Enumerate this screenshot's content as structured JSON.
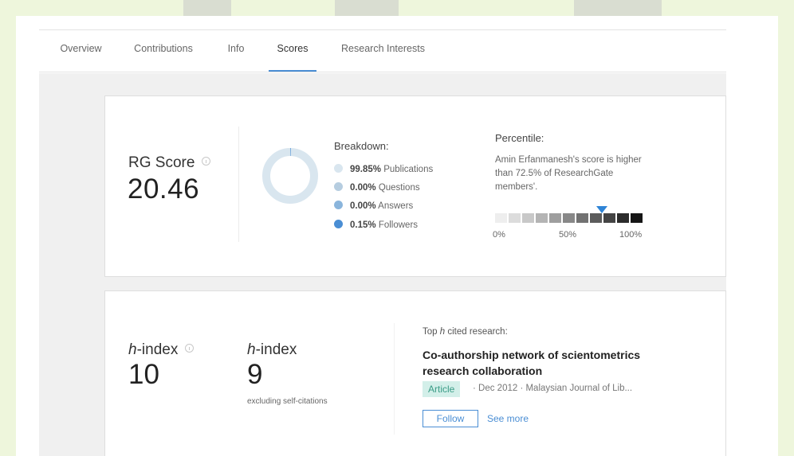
{
  "tabs": [
    {
      "label": "Overview"
    },
    {
      "label": "Contributions"
    },
    {
      "label": "Info"
    },
    {
      "label": "Scores",
      "active": true
    },
    {
      "label": "Research Interests"
    }
  ],
  "rg_score": {
    "label": "RG Score",
    "value": "20.46"
  },
  "breakdown": {
    "title": "Breakdown:",
    "items": [
      {
        "percent": "99.85%",
        "name": "Publications",
        "color": "#d9e6ef"
      },
      {
        "percent": "0.00%",
        "name": "Questions",
        "color": "#b6cde0"
      },
      {
        "percent": "0.00%",
        "name": "Answers",
        "color": "#8ab5dc"
      },
      {
        "percent": "0.15%",
        "name": "Followers",
        "color": "#4a8ed4"
      }
    ],
    "donut_share": 0.9985
  },
  "percentile": {
    "title": "Percentile:",
    "text": "Amin Erfanmanesh's score is higher than 72.5% of ResearchGate members'.",
    "value": 72.5,
    "ticks": [
      "0%",
      "50%",
      "100%"
    ],
    "scale_colors": [
      "#eeeeee",
      "#dcdcdc",
      "#c8c8c8",
      "#b4b4b4",
      "#9e9e9e",
      "#888888",
      "#727272",
      "#5c5c5c",
      "#444444",
      "#2c2c2c",
      "#161616"
    ],
    "marker_color": "#2e84d6"
  },
  "h_index": {
    "label_italic": "h",
    "label_rest": "-index",
    "value": "10"
  },
  "h_index_excl": {
    "label_italic": "h",
    "label_rest": "-index",
    "value": "9",
    "subtitle": "excluding self-citations"
  },
  "top_cited": {
    "prefix": "Top ",
    "italic": "h",
    "suffix": " cited research:",
    "title": "Co-authorship network of scientometrics research collaboration",
    "type": "Article",
    "meta": "· Dec 2012 · Malaysian Journal of Lib...",
    "follow_label": "Follow",
    "see_more_label": "See more"
  }
}
